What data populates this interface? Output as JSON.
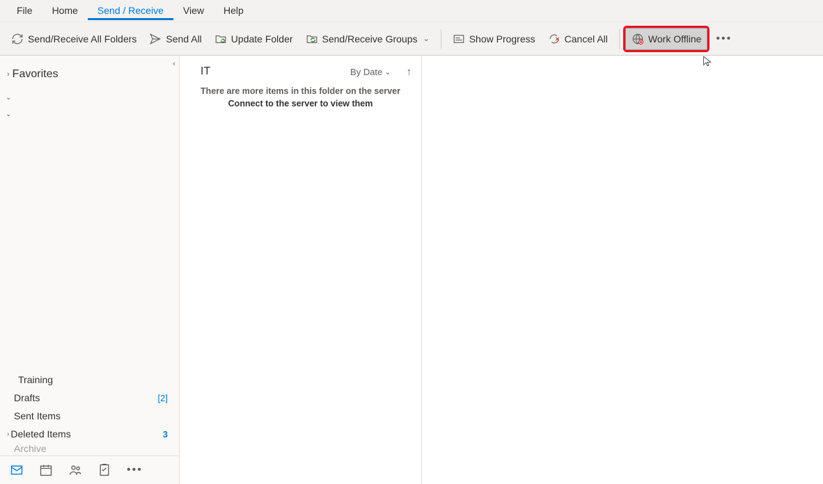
{
  "menu": {
    "items": [
      "File",
      "Home",
      "Send / Receive",
      "View",
      "Help"
    ],
    "activeIndex": 2
  },
  "toolbar": {
    "send_receive_all": "Send/Receive All Folders",
    "send_all": "Send All",
    "update_folder": "Update Folder",
    "send_receive_groups": "Send/Receive Groups",
    "show_progress": "Show Progress",
    "cancel_all": "Cancel All",
    "work_offline": "Work Offline"
  },
  "sidebar": {
    "favorites": "Favorites",
    "lower": {
      "training": "Training",
      "drafts": {
        "label": "Drafts",
        "count": "[2]"
      },
      "sent": "Sent Items",
      "deleted": {
        "label": "Deleted Items",
        "count": "3"
      },
      "archive": "Archive"
    }
  },
  "list": {
    "title": "IT",
    "sort": "By Date",
    "info1": "There are more items in this folder on the server",
    "info2": "Connect to the server to view them"
  }
}
